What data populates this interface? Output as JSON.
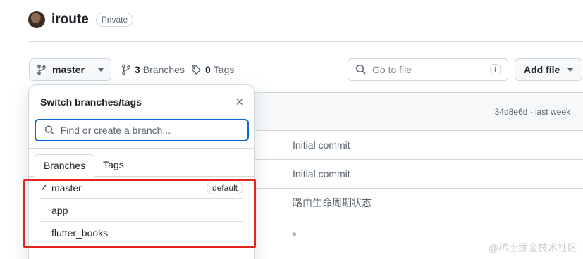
{
  "repo": {
    "name": "iroute",
    "visibility": "Private"
  },
  "toolbar": {
    "branch_label": "master",
    "branches_count": "3",
    "branches_label": "Branches",
    "tags_count": "0",
    "tags_label": "Tags",
    "goto_placeholder": "Go to file",
    "goto_shortcut": "t",
    "add_file_label": "Add file"
  },
  "commit_bar": {
    "text": "34d8e6d · last week"
  },
  "file_rows": [
    {
      "message": "Initial commit"
    },
    {
      "message": "Initial commit"
    },
    {
      "message": "路由生命周期状态"
    },
    {
      "message": "。"
    }
  ],
  "dropdown": {
    "title": "Switch branches/tags",
    "close": "×",
    "search_placeholder": "Find or create a branch...",
    "tabs": [
      {
        "label": "Branches"
      },
      {
        "label": "Tags"
      }
    ],
    "branches": [
      {
        "name": "master",
        "check": "✓",
        "badge": "default"
      },
      {
        "name": "app"
      },
      {
        "name": "flutter_books"
      }
    ]
  },
  "highlight_color": "#e3261f",
  "accent_color": "#0969da",
  "watermark": "@稀土掘金技术社区"
}
